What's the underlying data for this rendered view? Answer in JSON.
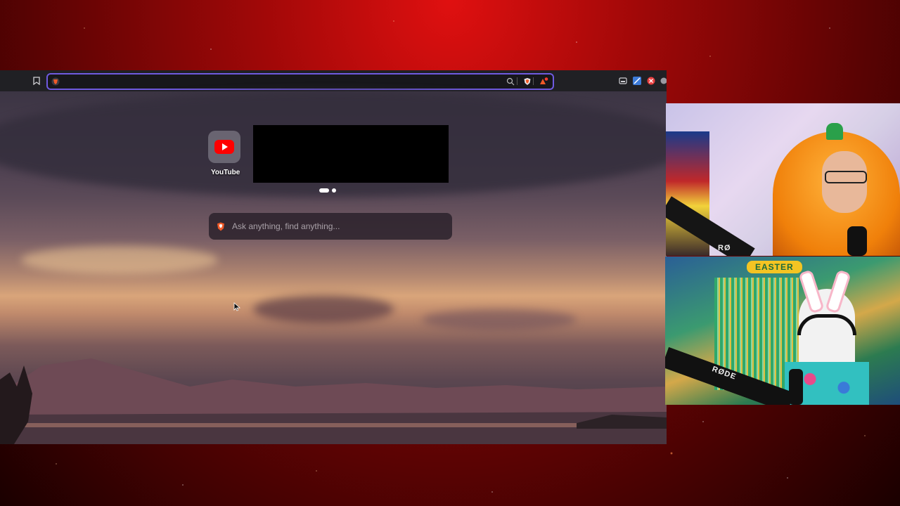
{
  "toolbar": {
    "bookmark_icon": "bookmark-icon",
    "site_icon": "brave-lion-icon",
    "address_value": "",
    "zoom_icon": "zoom-icon",
    "shield_icon": "brave-shield-icon",
    "rewards_icon": "brave-rewards-icon",
    "extensions": [
      "extension-1-icon",
      "extension-2-icon",
      "extension-3-icon",
      "extension-4-icon"
    ]
  },
  "new_tab": {
    "top_sites": [
      {
        "label": "YouTube",
        "icon": "youtube-icon"
      }
    ],
    "search": {
      "placeholder": "Ask anything, find anything..."
    }
  },
  "overlays": {
    "easter_banner": "EASTER",
    "mic_brand_top": "RØ",
    "mic_brand_bottom": "RØDE"
  },
  "colors": {
    "accent": "#6f5ae0",
    "youtube": "#ff0000",
    "background_red": "#c00a0a"
  }
}
